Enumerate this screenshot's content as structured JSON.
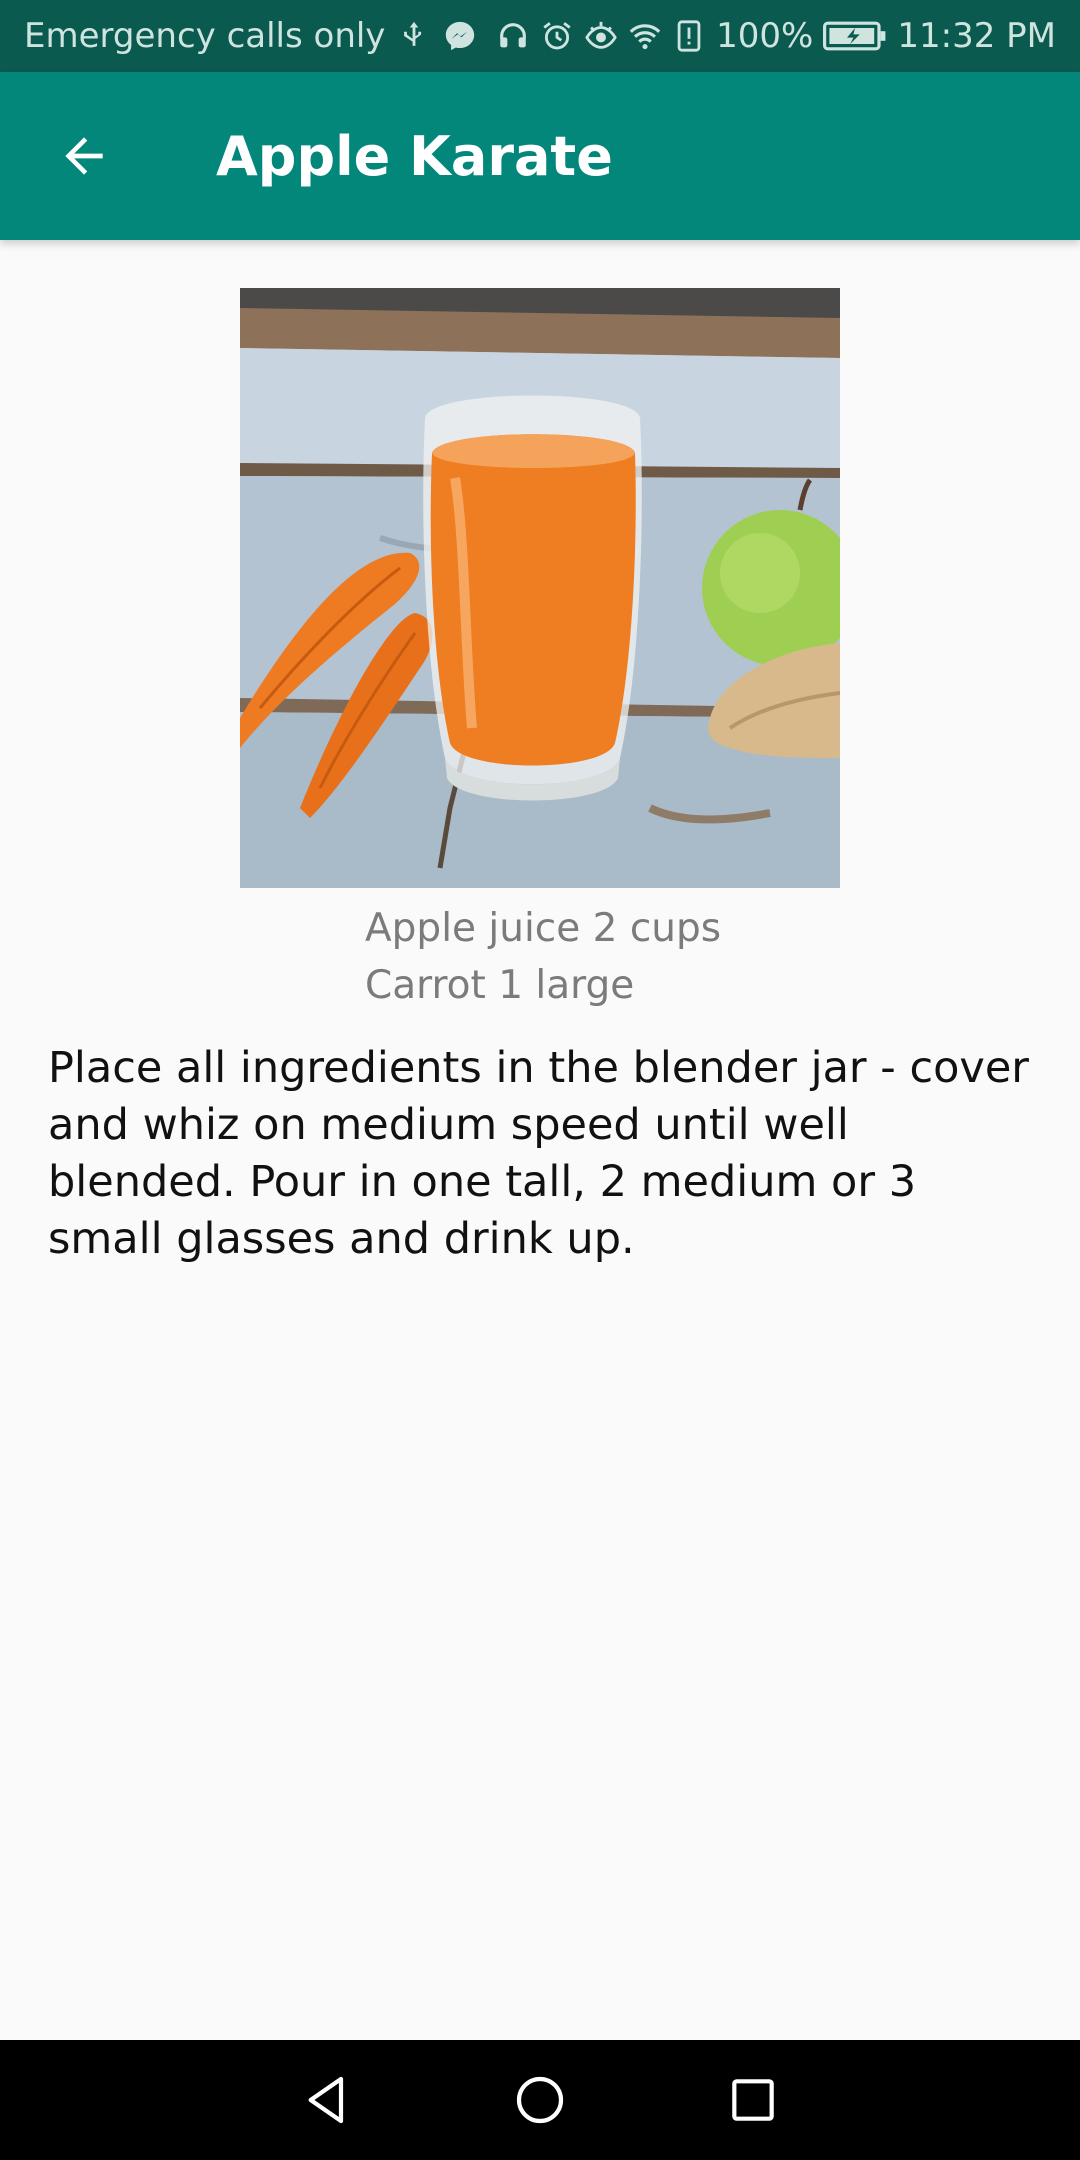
{
  "status_bar": {
    "carrier_text": "Emergency calls only",
    "battery": "100%",
    "time": "11:32 PM"
  },
  "app_bar": {
    "title": "Apple Karate"
  },
  "recipe": {
    "ingredients": [
      "Apple juice 2 cups",
      "Carrot 1 large"
    ],
    "instructions": "Place all ingredients in the blender jar - cover and whiz on medium speed until well blended. Pour in one tall, 2 medium or 3 small glasses and drink up."
  },
  "colors": {
    "status_bar": "#0b5a50",
    "app_bar": "#02877a",
    "background": "#fafafa",
    "ingredient_text": "#7b7b7b"
  }
}
